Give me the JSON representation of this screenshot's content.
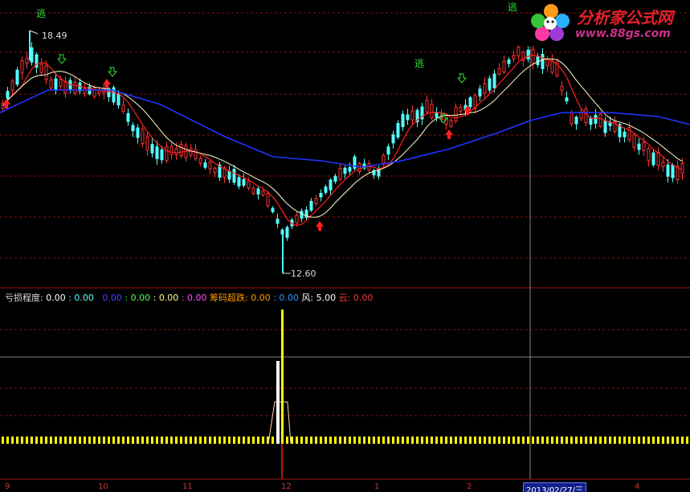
{
  "price_chart": {
    "high_label": "18.49",
    "low_label": "12.60",
    "escape_marks": [
      "逃",
      "逃",
      "逃"
    ]
  },
  "indicator": {
    "name": "亏损程度",
    "v1": "0.00",
    "v2": "0.00",
    "v3": "0.00",
    "v4": "0.00",
    "v5": "0.00",
    "v6": "0.00",
    "chip_label": "筹码超跌",
    "v7": "0.00",
    "v8": "0.00",
    "wind_label": "风",
    "wind_value": "5.00",
    "cloud_label": "云",
    "cloud_value": "0.00"
  },
  "axis": {
    "dates": [
      "9",
      "10",
      "11",
      "12",
      "1",
      "2",
      "4"
    ],
    "cursor_date": "2013/02/27/三"
  },
  "logo": {
    "title": "分析家公式网",
    "url": "www.88gs.com"
  },
  "colors": {
    "up": "#ff3333",
    "down": "#54ffff",
    "ma_white": "#ffffcc",
    "ma_red": "#ff2020",
    "ma_blue": "#2233ff",
    "grid": "#8a1010",
    "yellow": "#ffff00"
  }
}
